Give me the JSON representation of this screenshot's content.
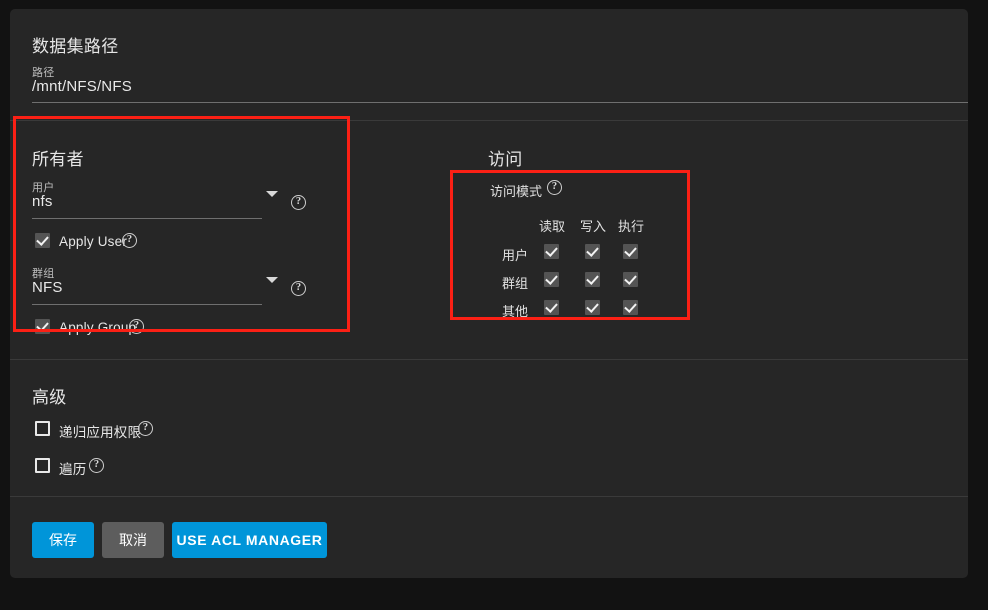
{
  "dataset_path": {
    "title": "数据集路径",
    "field_label": "路径",
    "field_value": "/mnt/NFS/NFS"
  },
  "owner": {
    "title": "所有者",
    "user": {
      "label": "用户",
      "value": "nfs",
      "caret": "chevron-down-icon",
      "help": "?"
    },
    "apply_user": {
      "label": "Apply User",
      "checked": true,
      "help": "?"
    },
    "group": {
      "label": "群组",
      "value": "NFS",
      "caret": "chevron-down-icon",
      "help": "?"
    },
    "apply_group": {
      "label": "Apply Group",
      "checked": true,
      "help": "?"
    }
  },
  "access": {
    "title": "访问",
    "mode_label": "访问模式",
    "mode_help": "?",
    "columns": [
      "读取",
      "写入",
      "执行"
    ],
    "rows": [
      {
        "label": "用户",
        "values": [
          true,
          true,
          true
        ]
      },
      {
        "label": "群组",
        "values": [
          true,
          true,
          true
        ]
      },
      {
        "label": "其他",
        "values": [
          true,
          true,
          true
        ]
      }
    ]
  },
  "advanced": {
    "title": "高级",
    "options": [
      {
        "label": "递归应用权限",
        "checked": false,
        "help": "?"
      },
      {
        "label": "遍历",
        "checked": false,
        "help": "?"
      }
    ]
  },
  "actions": {
    "save": "保存",
    "cancel": "取消",
    "acl_manager": "USE ACL MANAGER"
  },
  "colors": {
    "page_background": "#121212",
    "card_background": "#262626",
    "primary_button": "#0095d9",
    "secondary_button": "#5d5d5d",
    "annotation_outline": "#fb2015",
    "divider": "#3a3a3a",
    "underline": "#6f6f6f",
    "checkbox_checked_fill": "#545454",
    "text_primary": "#e9e9e9",
    "text_secondary": "#bdbdbd"
  }
}
